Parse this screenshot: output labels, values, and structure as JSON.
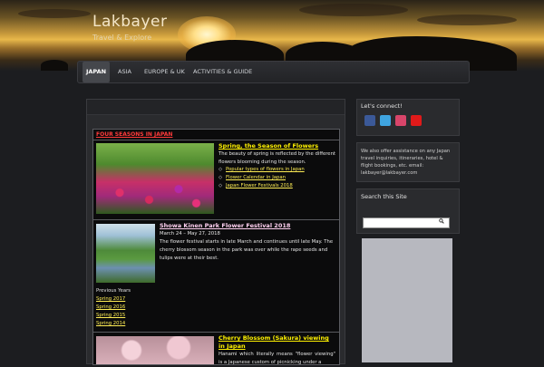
{
  "site": {
    "title": "Lakbayer",
    "tagline": "Travel & Explore"
  },
  "nav": {
    "items": [
      {
        "label": "JAPAN",
        "active": true
      },
      {
        "label": "ASIA",
        "active": false
      },
      {
        "label": "EUROPE & UK",
        "active": false
      },
      {
        "label": "ACTIVITIES & GUIDE",
        "active": false
      }
    ]
  },
  "main": {
    "table_title": "FOUR SEASONS IN JAPAN",
    "row1": {
      "title": "Spring, the Season of Flowers",
      "body": "The beauty of spring is reflected by the different flowers blooming during the season.",
      "links": [
        "Popular types of flowers in Japan",
        "Flower Calendar in Japan",
        "Japan Flower Festivals 2018"
      ]
    },
    "row2": {
      "title": "Showa Kinen Park Flower Festival 2018",
      "date": "March 24 – May 27, 2018",
      "body": "The flower festival starts in late March and continues until late May. The cherry blossom season in the park was over while the rape seeds and tulips were at their best.",
      "prev_label": "Previous Years",
      "prev_links": [
        "Spring 2017",
        "Spring 2016",
        "Spring 2015",
        "Spring 2014"
      ]
    },
    "row3": {
      "title": "Cherry Blossom (Sakura) viewing in Japan",
      "body": "Hanami which literally means \"flower viewing\" is a Japanese custom of picnicking under a"
    }
  },
  "sidebar": {
    "connect_title": "Let's connect!",
    "social": [
      {
        "name": "facebook-icon",
        "color": "#3b5998"
      },
      {
        "name": "twitter-icon",
        "color": "#3fa4e0"
      },
      {
        "name": "instagram-icon",
        "color": "#d8456a"
      },
      {
        "name": "youtube-icon",
        "color": "#e01a1a"
      }
    ],
    "assist_text": "We also offer assistance on any Japan travel inquiries, itineraries, hotel & flight bookings, etc. email: lakbayer@lakbayer.com",
    "search_title": "Search this Site",
    "search_placeholder": ""
  }
}
